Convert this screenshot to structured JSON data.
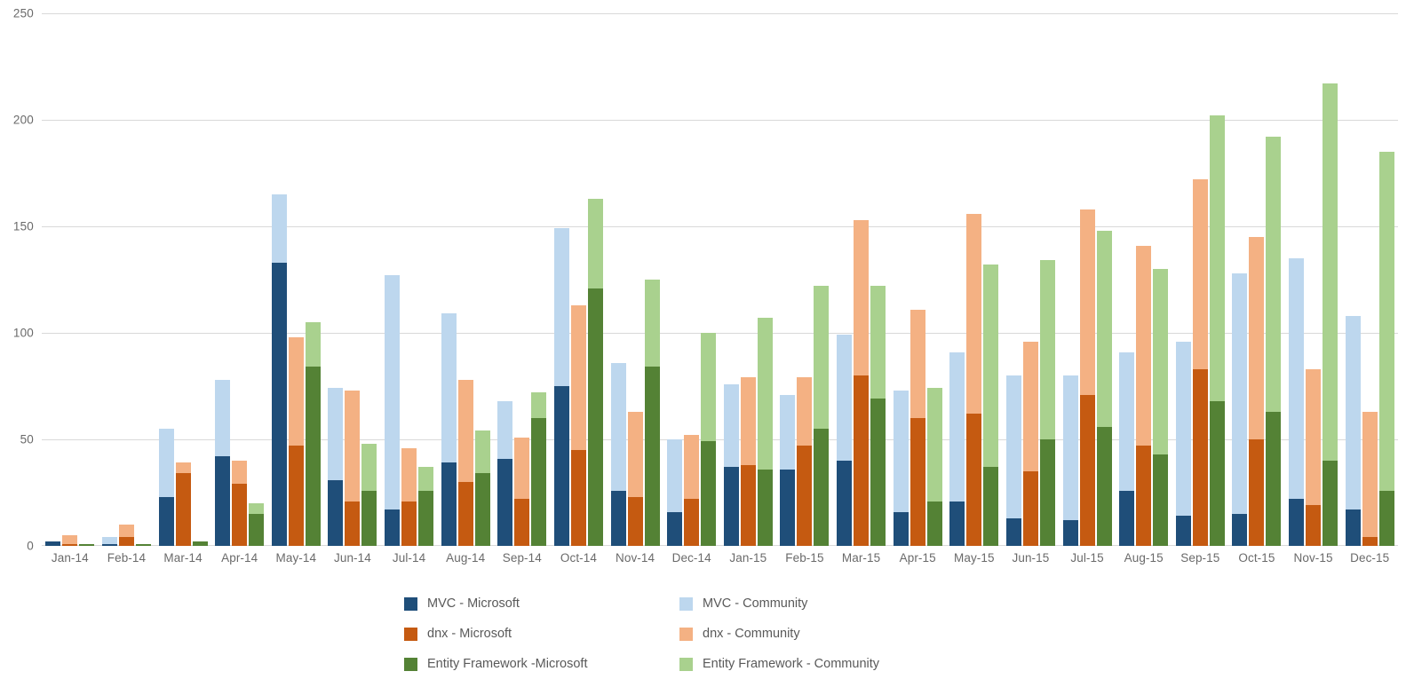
{
  "chart_data": {
    "type": "bar",
    "subtype": "stacked-grouped-column",
    "title": "",
    "xlabel": "",
    "ylabel": "",
    "ylim": [
      0,
      250
    ],
    "ytick_values": [
      0,
      50,
      100,
      150,
      200,
      250
    ],
    "ytick_labels": [
      "0",
      "50",
      "100",
      "150",
      "200",
      "250"
    ],
    "grid": true,
    "legend_position": "bottom",
    "categories": [
      "Jan-14",
      "Feb-14",
      "Mar-14",
      "Apr-14",
      "May-14",
      "Jun-14",
      "Jul-14",
      "Aug-14",
      "Sep-14",
      "Oct-14",
      "Nov-14",
      "Dec-14",
      "Jan-15",
      "Feb-15",
      "Mar-15",
      "Apr-15",
      "May-15",
      "Jun-15",
      "Jul-15",
      "Aug-15",
      "Sep-15",
      "Oct-15",
      "Nov-15",
      "Dec-15"
    ],
    "stacks": [
      {
        "name": "MVC",
        "series": [
          {
            "name": "MVC - Microsoft",
            "color": "#1F4E79",
            "values": [
              2,
              1,
              23,
              42,
              133,
              31,
              17,
              39,
              41,
              75,
              26,
              16,
              37,
              36,
              40,
              16,
              21,
              13,
              12,
              26,
              14,
              15,
              22,
              17
            ]
          },
          {
            "name": "MVC - Community",
            "color": "#BDD7EE",
            "values": [
              0,
              3,
              32,
              36,
              32,
              43,
              110,
              70,
              27,
              74,
              60,
              34,
              39,
              35,
              59,
              57,
              70,
              67,
              68,
              65,
              82,
              113,
              113,
              91
            ]
          }
        ]
      },
      {
        "name": "dnx",
        "series": [
          {
            "name": "dnx - Microsoft",
            "color": "#C55A11",
            "values": [
              1,
              4,
              34,
              29,
              47,
              21,
              21,
              30,
              22,
              45,
              23,
              22,
              38,
              47,
              80,
              60,
              62,
              35,
              71,
              47,
              83,
              50,
              19,
              4
            ]
          },
          {
            "name": "dnx - Community",
            "color": "#F4B183",
            "values": [
              4,
              6,
              5,
              11,
              51,
              52,
              25,
              48,
              29,
              68,
              40,
              30,
              41,
              32,
              73,
              51,
              94,
              61,
              87,
              94,
              89,
              95,
              64,
              59
            ]
          }
        ]
      },
      {
        "name": "Entity Framework",
        "series": [
          {
            "name": "Entity Framework -Microsoft",
            "color": "#548235",
            "values": [
              1,
              1,
              2,
              15,
              84,
              26,
              26,
              34,
              60,
              121,
              84,
              49,
              36,
              55,
              69,
              21,
              37,
              50,
              56,
              43,
              68,
              63,
              40,
              26
            ]
          },
          {
            "name": "Entity Framework - Community",
            "color": "#A9D18E",
            "values": [
              0,
              0,
              0,
              5,
              21,
              22,
              11,
              20,
              12,
              42,
              41,
              51,
              71,
              67,
              53,
              53,
              95,
              84,
              92,
              87,
              134,
              129,
              177,
              159
            ]
          }
        ]
      }
    ],
    "totals_note": {
      "MVC_totals": [
        2,
        4,
        55,
        78,
        165,
        74,
        127,
        109,
        68,
        149,
        86,
        50,
        76,
        71,
        99,
        73,
        91,
        80,
        80,
        91,
        96,
        128,
        135,
        108
      ],
      "dnx_totals": [
        5,
        10,
        39,
        40,
        98,
        73,
        46,
        78,
        51,
        113,
        63,
        52,
        79,
        79,
        153,
        111,
        156,
        96,
        158,
        141,
        172,
        145,
        83,
        63
      ],
      "ef_totals": [
        1,
        1,
        2,
        20,
        105,
        48,
        37,
        54,
        72,
        163,
        125,
        100,
        107,
        122,
        122,
        74,
        132,
        134,
        148,
        130,
        202,
        192,
        217,
        185
      ]
    }
  },
  "legend": {
    "items": [
      {
        "label": "MVC - Microsoft",
        "color": "#1F4E79"
      },
      {
        "label": "MVC - Community",
        "color": "#BDD7EE"
      },
      {
        "label": "dnx - Microsoft",
        "color": "#C55A11"
      },
      {
        "label": "dnx - Community",
        "color": "#F4B183"
      },
      {
        "label": "Entity Framework -Microsoft",
        "color": "#548235"
      },
      {
        "label": "Entity Framework - Community",
        "color": "#A9D18E"
      }
    ]
  }
}
